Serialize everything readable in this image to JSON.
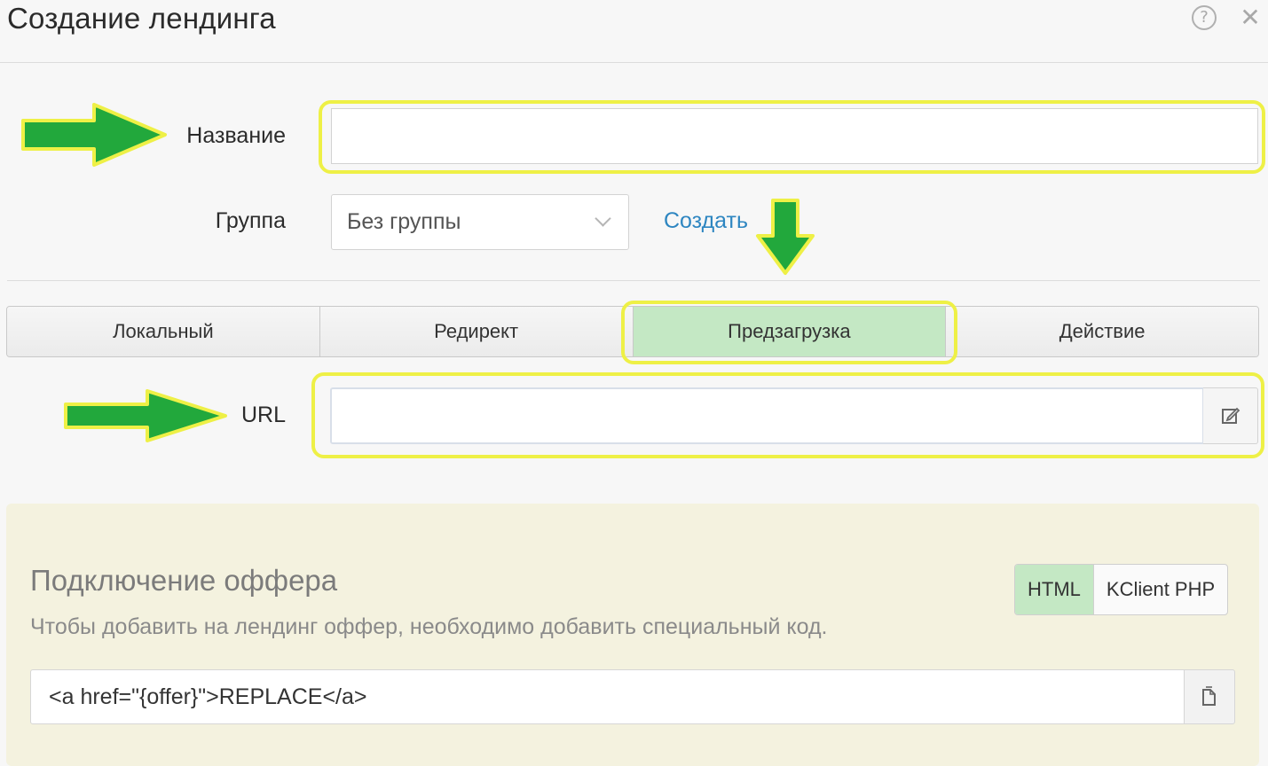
{
  "dialog": {
    "title": "Создание лендинга",
    "help_icon": "?",
    "close_icon": "✕"
  },
  "form": {
    "name_label": "Название",
    "name_value": "",
    "group_label": "Группа",
    "group_value": "Без группы",
    "create_link": "Создать",
    "url_label": "URL",
    "url_value": ""
  },
  "tabs": [
    {
      "label": "Локальный",
      "active": false
    },
    {
      "label": "Редирект",
      "active": false
    },
    {
      "label": "Предзагрузка",
      "active": true
    },
    {
      "label": "Действие",
      "active": false
    }
  ],
  "offer": {
    "title": "Подключение оффера",
    "description": "Чтобы добавить на лендинг оффер, необходимо добавить специальный код.",
    "formats": [
      {
        "label": "HTML",
        "active": true
      },
      {
        "label": "KClient PHP",
        "active": false
      }
    ],
    "code": "<a href=\"{offer}\">REPLACE</a>"
  },
  "colors": {
    "highlight": "#eef046",
    "arrow": "#22a83c",
    "active_tab": "#c4e8c4",
    "link": "#2e86c1",
    "panel": "#f4f2df"
  },
  "icons": {
    "help": "help-circle-icon",
    "close": "close-icon",
    "select": "chevron-down-icon",
    "edit": "edit-icon",
    "copy": "copy-icon"
  }
}
